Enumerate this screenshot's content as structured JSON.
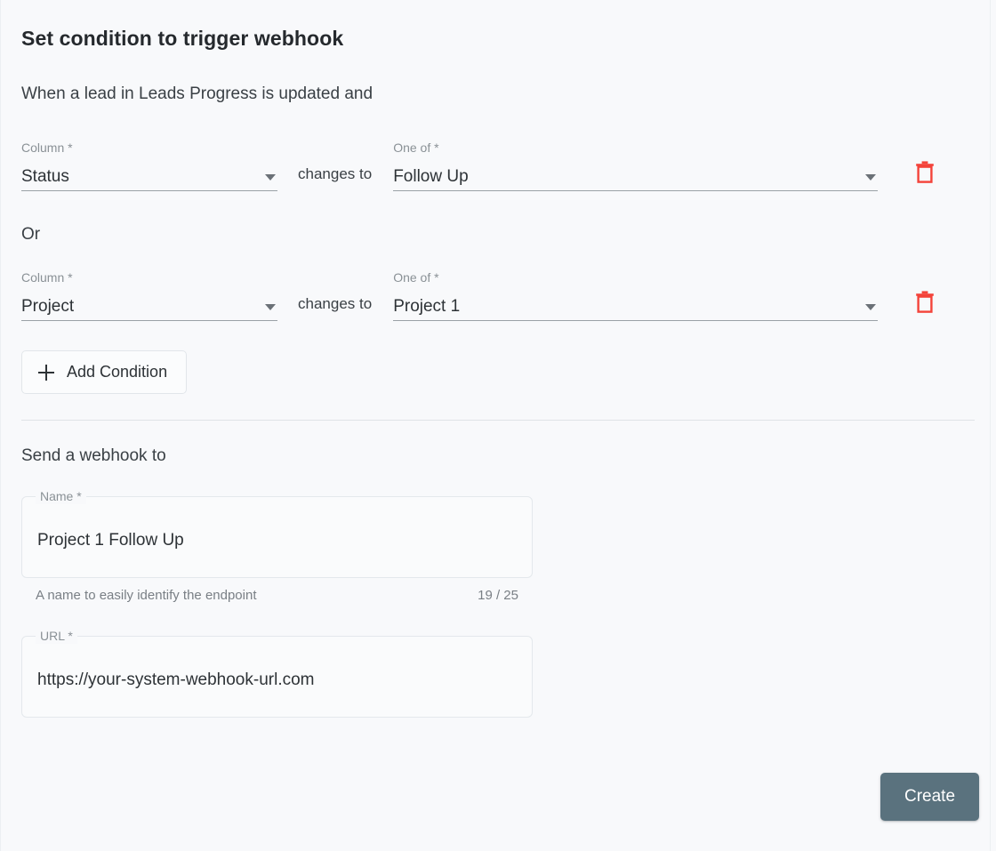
{
  "dialog": {
    "title": "Set condition to trigger webhook",
    "trigger_sentence": "When a lead in Leads Progress is updated and",
    "or_label": "Or"
  },
  "conditions": [
    {
      "column_label": "Column *",
      "column_value": "Status",
      "operator": "changes to",
      "value_label": "One of *",
      "value_value": "Follow Up",
      "delete_icon": "trash-icon"
    },
    {
      "column_label": "Column *",
      "column_value": "Project",
      "operator": "changes to",
      "value_label": "One of *",
      "value_value": "Project 1",
      "delete_icon": "trash-icon"
    }
  ],
  "add_condition": {
    "label": "Add Condition",
    "icon": "plus-icon"
  },
  "webhook": {
    "section_label": "Send a webhook to",
    "name_field": {
      "label": "Name *",
      "value": "Project 1 Follow Up",
      "helper": "A name to easily identify the endpoint",
      "counter": "19 / 25"
    },
    "url_field": {
      "label": "URL *",
      "value": "https://your-system-webhook-url.com"
    }
  },
  "footer": {
    "create_label": "Create"
  },
  "colors": {
    "background": "#f8f9fb",
    "primary_button": "#5a727e",
    "delete_icon": "#f44336",
    "label_text": "#8a9196",
    "body_text": "#2d3236"
  }
}
